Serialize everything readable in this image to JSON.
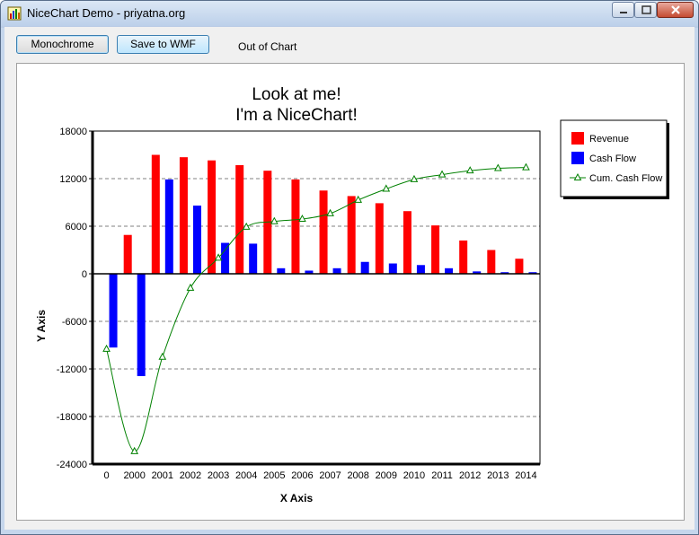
{
  "window": {
    "title": "NiceChart Demo - priyatna.org"
  },
  "toolbar": {
    "monochrome_label": "Monochrome",
    "save_wmf_label": "Save to WMF",
    "out_of_chart_label": "Out of Chart"
  },
  "chart_data": {
    "type": "bar",
    "title": "Look at me!",
    "subtitle": "I'm a NiceChart!",
    "xlabel": "X Axis",
    "ylabel": "Y Axis",
    "ylim": [
      -24000,
      18000
    ],
    "yticks": [
      18000,
      12000,
      6000,
      0,
      -6000,
      -12000,
      -18000,
      -24000
    ],
    "grid": true,
    "legend_position": "right",
    "categories": [
      "0",
      "2000",
      "2001",
      "2002",
      "2003",
      "2004",
      "2005",
      "2006",
      "2007",
      "2008",
      "2009",
      "2010",
      "2011",
      "2012",
      "2013",
      "2014"
    ],
    "series": [
      {
        "name": "Revenue",
        "type": "bar",
        "color": "#ff0000",
        "values": [
          0,
          4900,
          15000,
          14700,
          14300,
          13700,
          13000,
          11900,
          10500,
          9800,
          8900,
          7900,
          6100,
          4200,
          3000,
          1900
        ]
      },
      {
        "name": "Cash Flow",
        "type": "bar",
        "color": "#0000ff",
        "values": [
          -9300,
          -12900,
          11900,
          8600,
          3900,
          3800,
          700,
          400,
          700,
          1500,
          1300,
          1100,
          700,
          300,
          200,
          200
        ]
      },
      {
        "name": "Cum. Cash Flow",
        "type": "line",
        "color": "#008000",
        "marker": "triangle",
        "values": [
          -9500,
          -22400,
          -10500,
          -1800,
          2000,
          5900,
          6600,
          6900,
          7600,
          9300,
          10700,
          11900,
          12500,
          13000,
          13300,
          13400
        ]
      }
    ]
  }
}
